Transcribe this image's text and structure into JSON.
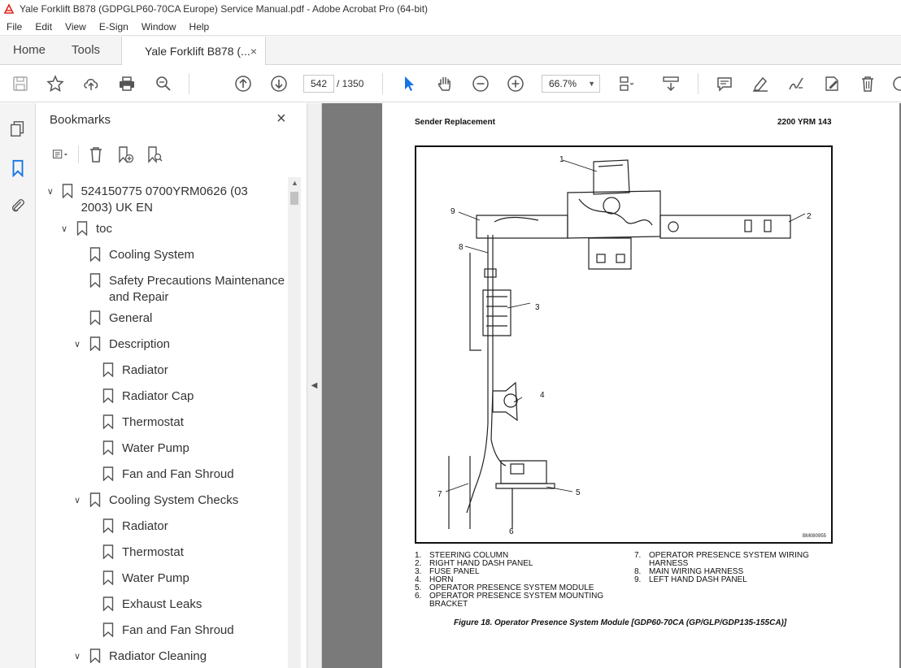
{
  "window": {
    "title": "Yale Forklift B878 (GDPGLP60-70CA Europe) Service Manual.pdf - Adobe Acrobat Pro (64-bit)"
  },
  "menu": [
    "File",
    "Edit",
    "View",
    "E-Sign",
    "Window",
    "Help"
  ],
  "tabs": {
    "home": "Home",
    "tools": "Tools",
    "document": "Yale Forklift B878 (...",
    "close": "×"
  },
  "toolbar": {
    "page_current": "542",
    "page_total": "/ 1350",
    "zoom": "66.7%"
  },
  "bookmarks": {
    "title": "Bookmarks",
    "close": "×",
    "items": [
      {
        "label": "524150775 0700YRM0626 (03 2003) UK EN",
        "expander": "v"
      },
      {
        "label": "toc",
        "expander": "v"
      },
      {
        "label": "Cooling System",
        "expander": ""
      },
      {
        "label": "Safety Precautions Maintenance and Repair",
        "expander": ""
      },
      {
        "label": "General",
        "expander": ""
      },
      {
        "label": "Description",
        "expander": "v"
      },
      {
        "label": "Radiator",
        "expander": ""
      },
      {
        "label": "Radiator Cap",
        "expander": ""
      },
      {
        "label": "Thermostat",
        "expander": ""
      },
      {
        "label": "Water Pump",
        "expander": ""
      },
      {
        "label": "Fan and Fan Shroud",
        "expander": ""
      },
      {
        "label": "Cooling System Checks",
        "expander": "v"
      },
      {
        "label": "Radiator",
        "expander": ""
      },
      {
        "label": "Thermostat",
        "expander": ""
      },
      {
        "label": "Water Pump",
        "expander": ""
      },
      {
        "label": "Exhaust Leaks",
        "expander": ""
      },
      {
        "label": "Fan and Fan Shroud",
        "expander": ""
      },
      {
        "label": "Radiator Cleaning",
        "expander": "v"
      }
    ]
  },
  "document_page": {
    "header_left": "Sender Replacement",
    "header_right": "2200 YRM 143",
    "figure_code": "BM080955",
    "callouts": [
      "1",
      "2",
      "3",
      "4",
      "5",
      "6",
      "7",
      "8",
      "9"
    ],
    "legend_left": [
      {
        "num": "1.",
        "text": "STEERING COLUMN"
      },
      {
        "num": "2.",
        "text": "RIGHT HAND DASH PANEL"
      },
      {
        "num": "3.",
        "text": "FUSE PANEL"
      },
      {
        "num": "4.",
        "text": "HORN"
      },
      {
        "num": "5.",
        "text": "OPERATOR PRESENCE SYSTEM MODULE"
      },
      {
        "num": "6.",
        "text": "OPERATOR PRESENCE SYSTEM MOUNTING BRACKET"
      }
    ],
    "legend_right": [
      {
        "num": "7.",
        "text": "OPERATOR PRESENCE SYSTEM WIRING HARNESS"
      },
      {
        "num": "8.",
        "text": "MAIN WIRING HARNESS"
      },
      {
        "num": "9.",
        "text": "LEFT HAND DASH PANEL"
      }
    ],
    "caption": "Figure 18. Operator Presence System Module [GDP60-70CA (GP/GLP/GDP135-155CA)]"
  }
}
